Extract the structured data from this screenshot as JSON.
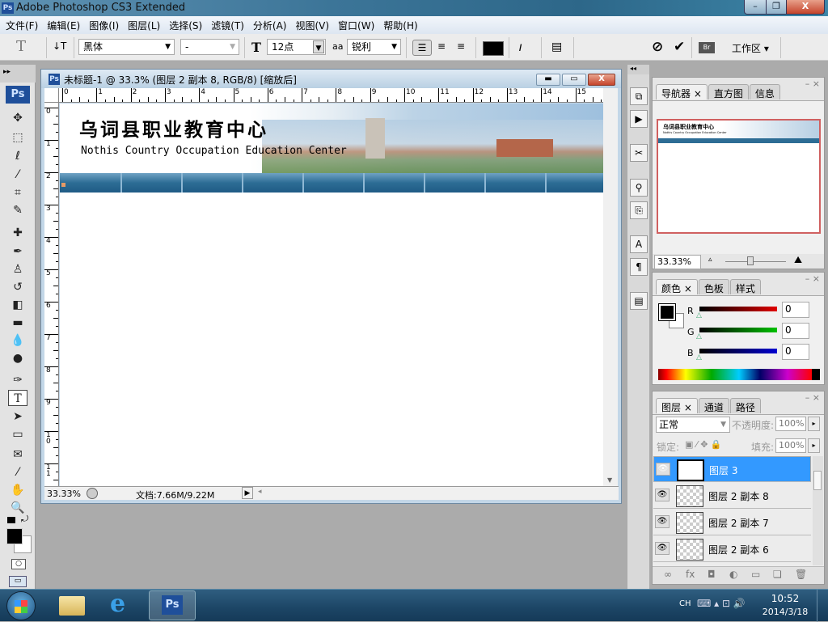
{
  "app": {
    "title": "Adobe Photoshop CS3 Extended",
    "logo": "Ps"
  },
  "window_controls": {
    "minimize": "–",
    "restore": "❐",
    "close": "X"
  },
  "menu": [
    "文件(F)",
    "编辑(E)",
    "图像(I)",
    "图层(L)",
    "选择(S)",
    "滤镜(T)",
    "分析(A)",
    "视图(V)",
    "窗口(W)",
    "帮助(H)"
  ],
  "options": {
    "tool_glyph": "T",
    "orient_glyph": "↓T",
    "font_family": "黑体",
    "font_style": "-",
    "size_glyph": "T",
    "font_size": "12点",
    "aa_glyph": "aa",
    "antialias": "锐利",
    "text_color": "#000000",
    "cancel": "⊘",
    "commit": "✔",
    "bridge": "Br",
    "workspace": "工作区 ▾"
  },
  "document": {
    "title": "未标题-1 @ 33.3% (图层 2 副本 8, RGB/8) [缩放后]",
    "ruler_top": [
      "0",
      "1",
      "2",
      "3",
      "4",
      "5",
      "6",
      "7",
      "8",
      "9",
      "10",
      "11",
      "12",
      "13",
      "14",
      "15"
    ],
    "ruler_left": [
      "0",
      "1",
      "2",
      "3",
      "4",
      "5",
      "6",
      "7",
      "8",
      "9",
      "10",
      "11"
    ],
    "banner_cn": "乌词县职业教育中心",
    "banner_en": "Nothis Country Occupation Education Center",
    "zoom": "33.33%",
    "doc_size": "文档:7.66M/9.22M"
  },
  "navigator": {
    "tabs": [
      "导航器",
      "直方图",
      "信息"
    ],
    "zoom": "33.33%",
    "preview_cn": "乌词县职业教育中心",
    "preview_en": "Nothis Country Occupation Education Center"
  },
  "color": {
    "tabs": [
      "颜色",
      "色板",
      "样式"
    ],
    "channels": [
      {
        "label": "R",
        "value": "0",
        "color": "#e00000"
      },
      {
        "label": "G",
        "value": "0",
        "color": "#00c000"
      },
      {
        "label": "B",
        "value": "0",
        "color": "#0000d0"
      }
    ]
  },
  "layers": {
    "tabs": [
      "图层",
      "通道",
      "路径"
    ],
    "blend_mode": "正常",
    "opacity_label": "不透明度:",
    "opacity": "100%",
    "lock_label": "锁定:",
    "fill_label": "填充:",
    "fill": "100%",
    "items": [
      {
        "name": "图层 3",
        "type": "text",
        "selected": true
      },
      {
        "name": "图层 2 副本 8"
      },
      {
        "name": "图层 2 副本 7"
      },
      {
        "name": "图层 2 副本 6"
      }
    ],
    "footer_icons": [
      "∞",
      "fx",
      "◘",
      "◐",
      "▭",
      "❏",
      "🗑"
    ]
  },
  "taskbar": {
    "apps": [
      "explorer",
      "ie",
      "photoshop"
    ],
    "ps_label": "Ps",
    "ie_label": "e",
    "lang": "CH",
    "time": "10:52",
    "date": "2014/3/18"
  }
}
